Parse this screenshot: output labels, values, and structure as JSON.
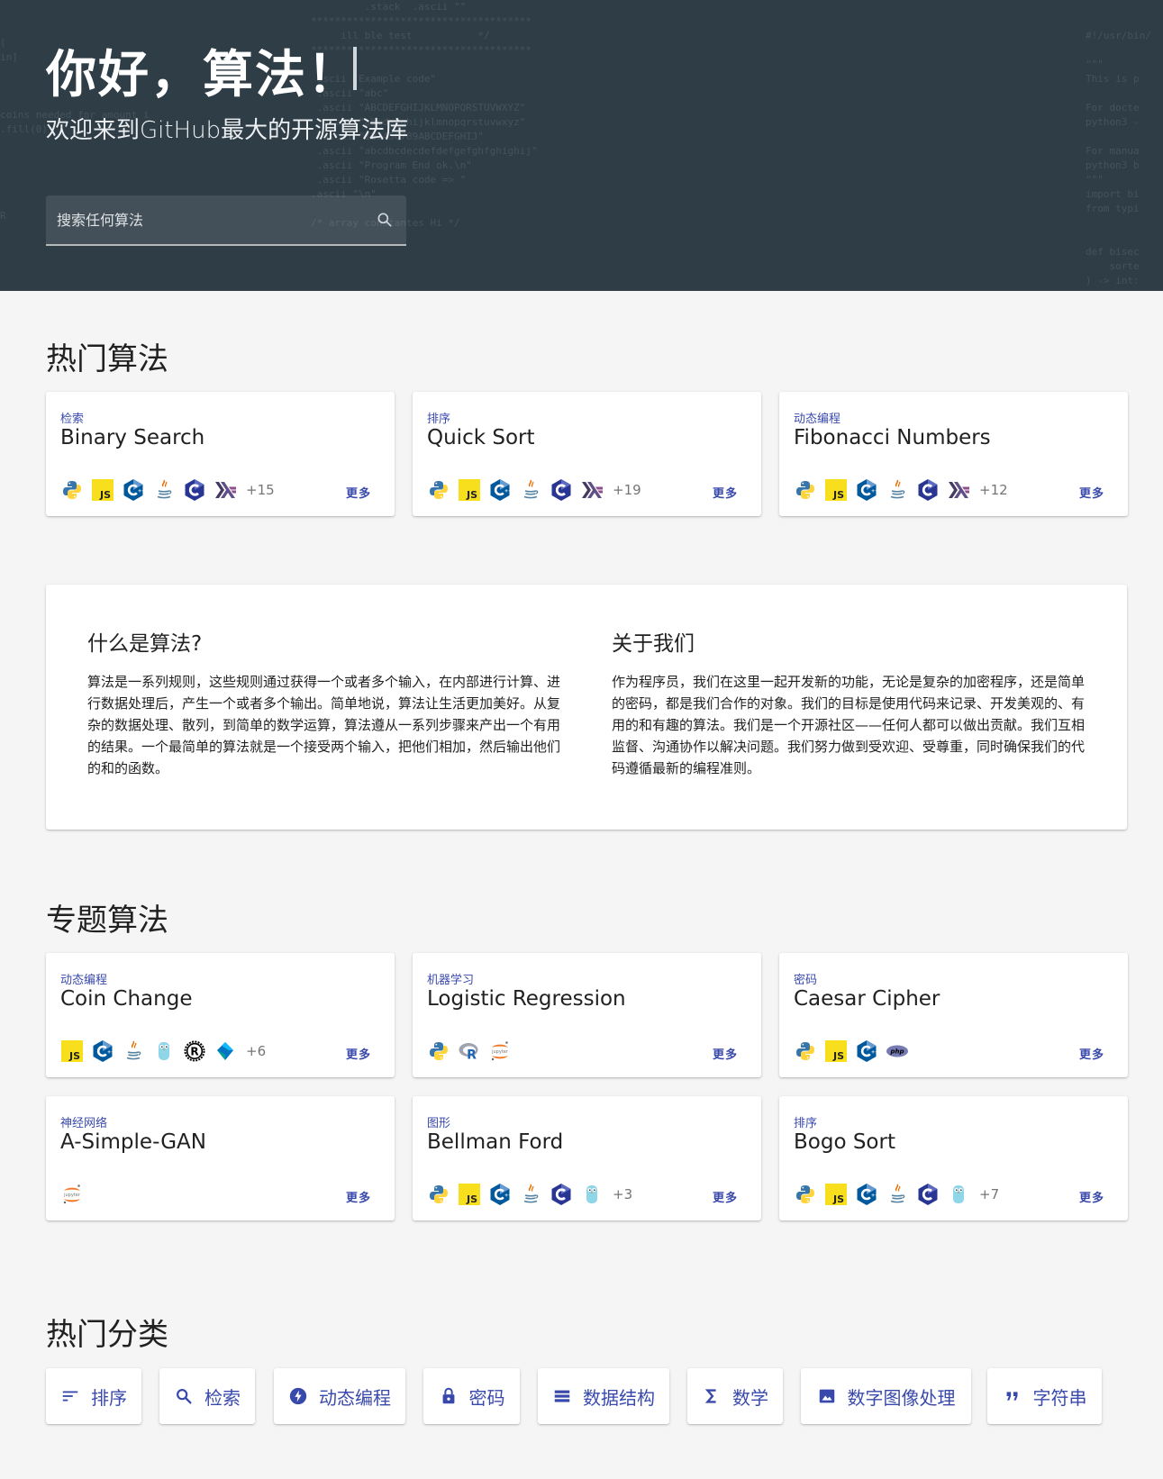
{
  "hero": {
    "title": "你好，算法！",
    "subtitle": "欢迎来到GitHub最大的开源算法库",
    "search_placeholder": "搜索任何算法"
  },
  "sections": {
    "popular": "热门算法",
    "featured": "专题算法",
    "categories": "热门分类"
  },
  "more_label": "更多",
  "popular_cards": [
    {
      "category": "检索",
      "name": "Binary Search",
      "langs": [
        "python",
        "javascript",
        "cpp",
        "java",
        "c",
        "haskell"
      ],
      "extra": "+15"
    },
    {
      "category": "排序",
      "name": "Quick Sort",
      "langs": [
        "python",
        "javascript",
        "cpp",
        "java",
        "c",
        "haskell"
      ],
      "extra": "+19"
    },
    {
      "category": "动态编程",
      "name": "Fibonacci Numbers",
      "langs": [
        "python",
        "javascript",
        "cpp",
        "java",
        "c",
        "haskell"
      ],
      "extra": "+12"
    }
  ],
  "featured_cards": [
    {
      "category": "动态编程",
      "name": "Coin Change",
      "langs": [
        "javascript",
        "cpp",
        "java",
        "go",
        "rust",
        "dart"
      ],
      "extra": "+6"
    },
    {
      "category": "机器学习",
      "name": "Logistic Regression",
      "langs": [
        "python",
        "r",
        "jupyter"
      ],
      "extra": ""
    },
    {
      "category": "密码",
      "name": "Caesar Cipher",
      "langs": [
        "python",
        "javascript",
        "cpp",
        "php"
      ],
      "extra": ""
    },
    {
      "category": "神经网络",
      "name": "A-Simple-GAN",
      "langs": [
        "jupyter"
      ],
      "extra": ""
    },
    {
      "category": "图形",
      "name": "Bellman Ford",
      "langs": [
        "python",
        "javascript",
        "cpp",
        "java",
        "c",
        "go"
      ],
      "extra": "+3"
    },
    {
      "category": "排序",
      "name": "Bogo Sort",
      "langs": [
        "python",
        "javascript",
        "cpp",
        "java",
        "c",
        "go"
      ],
      "extra": "+7"
    }
  ],
  "about": {
    "left_title": "什么是算法?",
    "left_text": "算法是一系列规则，这些规则通过获得一个或者多个输入，在内部进行计算、进行数据处理后，产生一个或者多个输出。简单地说，算法让生活更加美好。从复杂的数据处理、散列，到简单的数学运算，算法遵从一系列步骤来产出一个有用的结果。一个最简单的算法就是一个接受两个输入，把他们相加，然后输出他们的和的函数。",
    "right_title": "关于我们",
    "right_text": "作为程序员，我们在这里一起开发新的功能，无论是复杂的加密程序，还是简单的密码，都是我们合作的对象。我们的目标是使用代码来记录、开发美观的、有用的和有趣的算法。我们是一个开源社区——任何人都可以做出贡献。我们互相监督、沟通协作以解决问题。我们努力做到受欢迎、受尊重，同时确保我们的代码遵循最新的编程准则。"
  },
  "categories": [
    {
      "label": "排序",
      "icon": "sort-icon"
    },
    {
      "label": "检索",
      "icon": "search-icon"
    },
    {
      "label": "动态编程",
      "icon": "bolt-icon"
    },
    {
      "label": "密码",
      "icon": "lock-icon"
    },
    {
      "label": "数据结构",
      "icon": "list-icon"
    },
    {
      "label": "数学",
      "icon": "sigma-icon"
    },
    {
      "label": "数字图像处理",
      "icon": "image-icon"
    },
    {
      "label": "字符串",
      "icon": "quote-icon"
    }
  ],
  "colors": {
    "hero_bg": "#2f3d47",
    "accent": "#3949ab",
    "page_bg": "#f5f5f5"
  }
}
